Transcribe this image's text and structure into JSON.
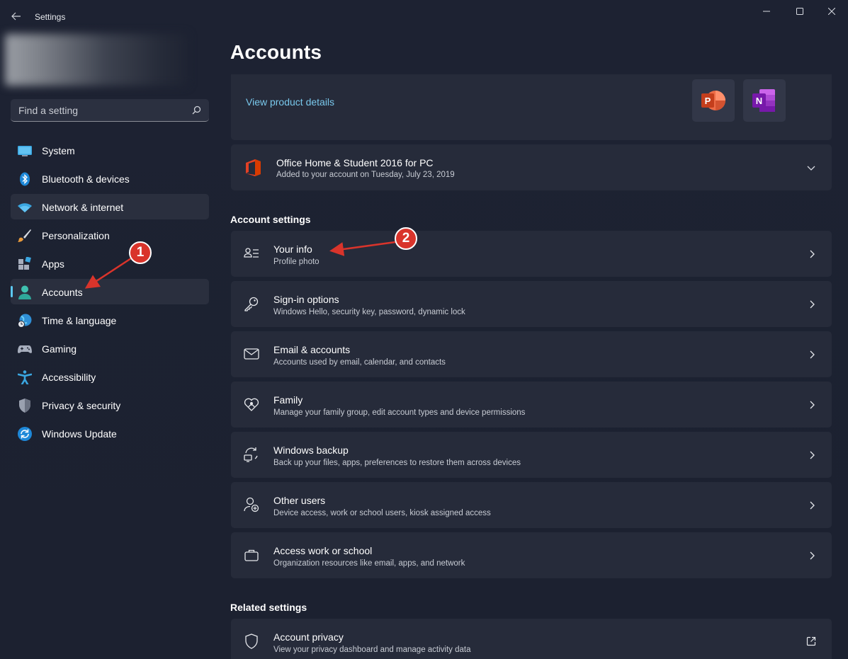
{
  "window": {
    "title": "Settings"
  },
  "search": {
    "placeholder": "Find a setting"
  },
  "sidebar": {
    "items": [
      {
        "label": "System"
      },
      {
        "label": "Bluetooth & devices"
      },
      {
        "label": "Network & internet"
      },
      {
        "label": "Personalization"
      },
      {
        "label": "Apps"
      },
      {
        "label": "Accounts"
      },
      {
        "label": "Time & language"
      },
      {
        "label": "Gaming"
      },
      {
        "label": "Accessibility"
      },
      {
        "label": "Privacy & security"
      },
      {
        "label": "Windows Update"
      }
    ]
  },
  "main": {
    "title": "Accounts",
    "product": {
      "link": "View product details",
      "office_title": "Office Home & Student 2016 for PC",
      "office_sub": "Added to your account on Tuesday, July 23, 2019"
    },
    "account_settings": {
      "heading": "Account settings",
      "rows": [
        {
          "title": "Your info",
          "sub": "Profile photo"
        },
        {
          "title": "Sign-in options",
          "sub": "Windows Hello, security key, password, dynamic lock"
        },
        {
          "title": "Email & accounts",
          "sub": "Accounts used by email, calendar, and contacts"
        },
        {
          "title": "Family",
          "sub": "Manage your family group, edit account types and device permissions"
        },
        {
          "title": "Windows backup",
          "sub": "Back up your files, apps, preferences to restore them across devices"
        },
        {
          "title": "Other users",
          "sub": "Device access, work or school users, kiosk assigned access"
        },
        {
          "title": "Access work or school",
          "sub": "Organization resources like email, apps, and network"
        }
      ]
    },
    "related_settings": {
      "heading": "Related settings",
      "rows": [
        {
          "title": "Account privacy",
          "sub": "View your privacy dashboard and manage activity data"
        }
      ]
    }
  },
  "annotations": {
    "badge1": "1",
    "badge2": "2"
  },
  "colors": {
    "background": "#1c2130",
    "card": "#262b3a",
    "accent": "#5cc8f0",
    "link": "#79c8ec",
    "annotation": "#d9342b"
  }
}
